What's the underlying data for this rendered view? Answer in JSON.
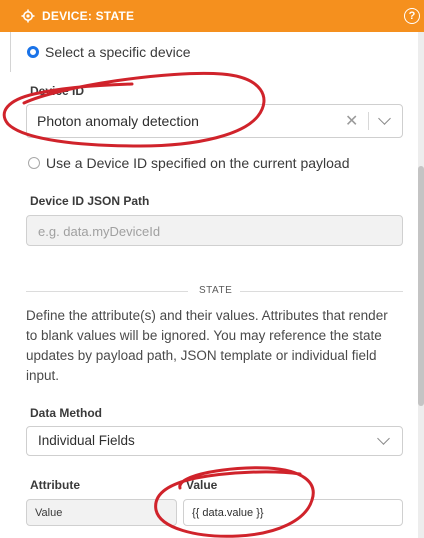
{
  "header": {
    "title": "DEVICE: STATE",
    "icon": "gear-icon",
    "help_glyph": "?",
    "bg_color": "#f5901e"
  },
  "device_mode": {
    "option_specific": "Select a specific device",
    "option_payload": "Use a Device ID specified on the current payload",
    "selected": "specific"
  },
  "device_id": {
    "label": "Device ID",
    "value": "Photon anomaly detection"
  },
  "device_id_json_path": {
    "label": "Device ID JSON Path",
    "placeholder": "e.g. data.myDeviceId"
  },
  "state_section": {
    "title": "STATE",
    "description": "Define the attribute(s) and their values. Attributes that render to blank values will be ignored. You may reference the state updates by payload path, JSON template or individual field input."
  },
  "data_method": {
    "label": "Data Method",
    "value": "Individual Fields"
  },
  "fields_table": {
    "attribute_header": "Attribute",
    "value_header": "Value",
    "rows": [
      {
        "attribute": "Value",
        "value": "{{ data.value  }}"
      }
    ]
  },
  "colors": {
    "accent": "#1a73e8",
    "annotation": "#d0232b"
  }
}
